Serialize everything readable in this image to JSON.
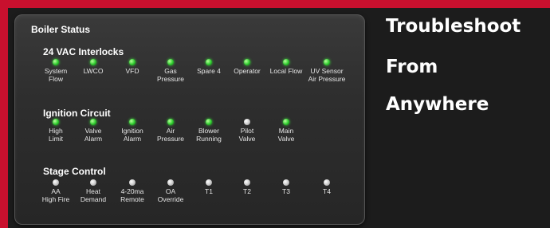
{
  "panel": {
    "title": "Boiler Status"
  },
  "sections": [
    {
      "title": "24 VAC Interlocks",
      "items": [
        {
          "label": "System\nFlow",
          "status": "on"
        },
        {
          "label": "LWCO",
          "status": "on"
        },
        {
          "label": "VFD",
          "status": "on"
        },
        {
          "label": "Gas\nPressure",
          "status": "on"
        },
        {
          "label": "Spare 4",
          "status": "on"
        },
        {
          "label": "Operator",
          "status": "on"
        },
        {
          "label": "Local Flow",
          "status": "on"
        },
        {
          "label": "UV Sensor\nAir Pressure",
          "status": "on"
        }
      ]
    },
    {
      "title": "Ignition Circuit",
      "items": [
        {
          "label": "High\nLimit",
          "status": "on"
        },
        {
          "label": "Valve\nAlarm",
          "status": "on"
        },
        {
          "label": "Ignition\nAlarm",
          "status": "on"
        },
        {
          "label": "Air\nPressure",
          "status": "on"
        },
        {
          "label": "Blower\nRunning",
          "status": "on"
        },
        {
          "label": "Pilot\nValve",
          "status": "off"
        },
        {
          "label": "Main\nValve",
          "status": "on"
        }
      ]
    },
    {
      "title": "Stage Control",
      "items": [
        {
          "label": "AA\nHigh Fire",
          "status": "off"
        },
        {
          "label": "Heat\nDemand",
          "status": "off"
        },
        {
          "label": "4-20ma\nRemote",
          "status": "off"
        },
        {
          "label": "OA\nOverride",
          "status": "off"
        },
        {
          "label": "T1",
          "status": "off"
        },
        {
          "label": "T2",
          "status": "off"
        },
        {
          "label": "T3",
          "status": "off"
        },
        {
          "label": "T4",
          "status": "off"
        }
      ]
    }
  ],
  "headline": [
    "Troubleshoot",
    "From",
    "Anywhere"
  ],
  "colors": {
    "accent": "#c8102e",
    "led_on": "#2fcc2f",
    "led_off": "#c7c7c7"
  }
}
